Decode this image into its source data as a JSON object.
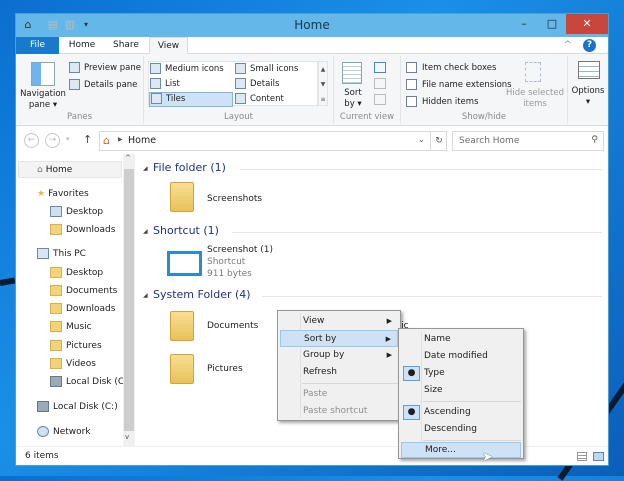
{
  "window": {
    "title": "Home",
    "min": "–",
    "max": "□",
    "close": "✕"
  },
  "tabs": [
    {
      "label": "File"
    },
    {
      "label": "Home"
    },
    {
      "label": "Share"
    },
    {
      "label": "View"
    }
  ],
  "ribbon": {
    "panes": {
      "label": "Panes",
      "navigation_pane": "Navigation",
      "navigation_pane2": "pane ▾",
      "preview_pane": "Preview pane",
      "details_pane": "Details pane"
    },
    "layout": {
      "label": "Layout",
      "items": [
        "Medium icons",
        "Small icons",
        "List",
        "Details",
        "Tiles",
        "Content"
      ],
      "selected": "Tiles"
    },
    "current_view": {
      "label": "Current view",
      "sort_by": "Sort",
      "sort_by2": "by ▾"
    },
    "show_hide": {
      "label": "Show/hide",
      "item_check_boxes": "Item check boxes",
      "file_name_extensions": "File name extensions",
      "hidden_items": "Hidden items",
      "hide_selected": "Hide selected",
      "hide_selected2": "items"
    },
    "options": {
      "label": "Options",
      "arrow": "▾"
    }
  },
  "address": {
    "path": "Home",
    "search_placeholder": "Search Home"
  },
  "nav": {
    "home": "Home",
    "favorites": "Favorites",
    "fav_items": [
      "Desktop",
      "Downloads"
    ],
    "this_pc": "This PC",
    "pc_items": [
      "Desktop",
      "Documents",
      "Downloads",
      "Music",
      "Pictures",
      "Videos",
      "Local Disk (C:)"
    ],
    "local_disk": "Local Disk (C:)",
    "network": "Network"
  },
  "content": {
    "groups": [
      {
        "header": "File folder (1)"
      },
      {
        "header": "Shortcut (1)"
      },
      {
        "header": "System Folder (4)"
      }
    ],
    "screenshots": "Screenshots",
    "shortcut": {
      "name": "Screenshot (1)",
      "type": "Shortcut",
      "size": "911 bytes"
    },
    "documents": "Documents",
    "music": "Music",
    "pictures": "Pictures"
  },
  "status": {
    "items": "6 items"
  },
  "context_menu": {
    "items": [
      "View",
      "Sort by",
      "Group by",
      "Refresh",
      "Paste",
      "Paste shortcut"
    ],
    "highlighted": "Sort by"
  },
  "sort_menu": {
    "items": [
      "Name",
      "Date modified",
      "Type",
      "Size",
      "Ascending",
      "Descending",
      "More..."
    ],
    "checked": [
      "Type",
      "Ascending"
    ],
    "highlighted": "More..."
  },
  "colors": {
    "accent": "#1979ca",
    "titlebar": "#64b7e9",
    "close": "#c9463d",
    "group_header": "#1e3287",
    "menu_highlight": "#cde3f5"
  }
}
